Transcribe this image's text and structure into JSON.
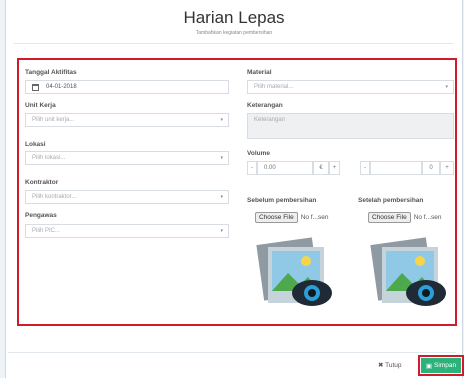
{
  "modal": {
    "title": "Harian Lepas",
    "subtitle": "Tambahkan kegiatan pembersihan"
  },
  "form": {
    "tanggal_label": "Tanggal Aktifitas",
    "tanggal_value": "04-01-2018",
    "unit_kerja_label": "Unit Kerja",
    "unit_kerja_placeholder": "Pilih unit kerja...",
    "lokasi_label": "Lokasi",
    "lokasi_placeholder": "Pilih lokasi...",
    "kontraktor_label": "Kontraktor",
    "kontraktor_placeholder": "Pilih kontraktor...",
    "pengawas_label": "Pengawas",
    "pengawas_placeholder": "Pilih PIC...",
    "material_label": "Material",
    "material_placeholder": "Pilih material...",
    "keterangan_label": "Keterangan",
    "keterangan_placeholder": "Keterangan",
    "volume_label": "Volume",
    "volume_value": "0.00",
    "volume_unit_1": "€",
    "volume_unit_2": "0",
    "before_label": "Sebelum pembersihan",
    "after_label": "Setelah pembersihan",
    "choose_file": "Choose File",
    "no_file": "No f...sen"
  },
  "footer": {
    "close_label": "Tutup",
    "save_label": "Simpan"
  },
  "colors": {
    "highlight": "#d11a2a",
    "save": "#2cb27a"
  }
}
